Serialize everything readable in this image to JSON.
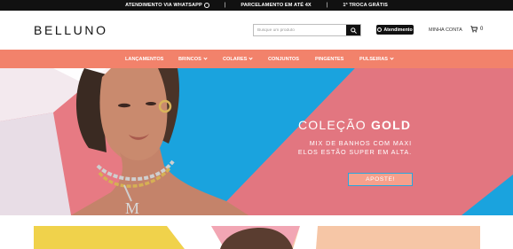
{
  "topbar": {
    "item1": "ATENDIMENTO VIA WHATSAPP",
    "item2": "PARCELAMENTO EM ATÉ 4X",
    "item3": "1ª TROCA GRÁTIS",
    "separator": "|"
  },
  "header": {
    "logo": "BELLUNO",
    "search_placeholder": "Busque um produto",
    "atendimento_label": "Atendimento",
    "minha_conta_label": "MINHA CONTA",
    "cart_count": "0"
  },
  "nav": {
    "items": [
      {
        "label": "LANÇAMENTOS",
        "has_dropdown": false
      },
      {
        "label": "BRINCOS",
        "has_dropdown": true
      },
      {
        "label": "COLARES",
        "has_dropdown": true
      },
      {
        "label": "CONJUNTOS",
        "has_dropdown": false
      },
      {
        "label": "PINGENTES",
        "has_dropdown": false
      },
      {
        "label": "PULSEIRAS",
        "has_dropdown": true
      }
    ]
  },
  "hero": {
    "title_part1": "COLEÇÃO",
    "title_part2": "GOLD",
    "subtitle": "MIX DE BANHOS COM MAXI ELOS ESTÃO SUPER EM ALTA.",
    "button_label": "APOSTE!",
    "pendant_letter": "M"
  },
  "colors": {
    "nav_bg": "#f2826b",
    "topbar_bg": "#111111",
    "hero_pink": "#e77a83",
    "hero_blue": "#1aa3de",
    "hero_button_border": "#27a6df"
  },
  "icons": {
    "whatsapp": "whatsapp-icon",
    "search": "search-icon",
    "cart": "cart-icon",
    "chevron": "chevron-down-icon"
  }
}
